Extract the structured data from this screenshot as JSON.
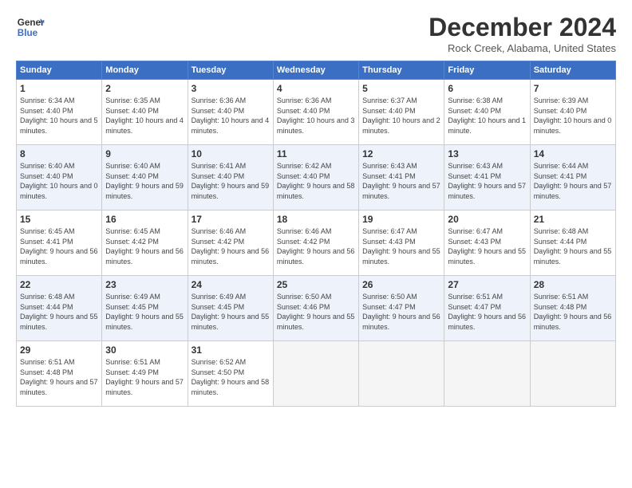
{
  "header": {
    "logo_line1": "General",
    "logo_line2": "Blue",
    "month_title": "December 2024",
    "location": "Rock Creek, Alabama, United States"
  },
  "days_of_week": [
    "Sunday",
    "Monday",
    "Tuesday",
    "Wednesday",
    "Thursday",
    "Friday",
    "Saturday"
  ],
  "weeks": [
    [
      {
        "day": "1",
        "sunrise": "6:34 AM",
        "sunset": "4:40 PM",
        "daylight": "10 hours and 5 minutes."
      },
      {
        "day": "2",
        "sunrise": "6:35 AM",
        "sunset": "4:40 PM",
        "daylight": "10 hours and 4 minutes."
      },
      {
        "day": "3",
        "sunrise": "6:36 AM",
        "sunset": "4:40 PM",
        "daylight": "10 hours and 4 minutes."
      },
      {
        "day": "4",
        "sunrise": "6:36 AM",
        "sunset": "4:40 PM",
        "daylight": "10 hours and 3 minutes."
      },
      {
        "day": "5",
        "sunrise": "6:37 AM",
        "sunset": "4:40 PM",
        "daylight": "10 hours and 2 minutes."
      },
      {
        "day": "6",
        "sunrise": "6:38 AM",
        "sunset": "4:40 PM",
        "daylight": "10 hours and 1 minute."
      },
      {
        "day": "7",
        "sunrise": "6:39 AM",
        "sunset": "4:40 PM",
        "daylight": "10 hours and 0 minutes."
      }
    ],
    [
      {
        "day": "8",
        "sunrise": "6:40 AM",
        "sunset": "4:40 PM",
        "daylight": "10 hours and 0 minutes."
      },
      {
        "day": "9",
        "sunrise": "6:40 AM",
        "sunset": "4:40 PM",
        "daylight": "9 hours and 59 minutes."
      },
      {
        "day": "10",
        "sunrise": "6:41 AM",
        "sunset": "4:40 PM",
        "daylight": "9 hours and 59 minutes."
      },
      {
        "day": "11",
        "sunrise": "6:42 AM",
        "sunset": "4:40 PM",
        "daylight": "9 hours and 58 minutes."
      },
      {
        "day": "12",
        "sunrise": "6:43 AM",
        "sunset": "4:41 PM",
        "daylight": "9 hours and 57 minutes."
      },
      {
        "day": "13",
        "sunrise": "6:43 AM",
        "sunset": "4:41 PM",
        "daylight": "9 hours and 57 minutes."
      },
      {
        "day": "14",
        "sunrise": "6:44 AM",
        "sunset": "4:41 PM",
        "daylight": "9 hours and 57 minutes."
      }
    ],
    [
      {
        "day": "15",
        "sunrise": "6:45 AM",
        "sunset": "4:41 PM",
        "daylight": "9 hours and 56 minutes."
      },
      {
        "day": "16",
        "sunrise": "6:45 AM",
        "sunset": "4:42 PM",
        "daylight": "9 hours and 56 minutes."
      },
      {
        "day": "17",
        "sunrise": "6:46 AM",
        "sunset": "4:42 PM",
        "daylight": "9 hours and 56 minutes."
      },
      {
        "day": "18",
        "sunrise": "6:46 AM",
        "sunset": "4:42 PM",
        "daylight": "9 hours and 56 minutes."
      },
      {
        "day": "19",
        "sunrise": "6:47 AM",
        "sunset": "4:43 PM",
        "daylight": "9 hours and 55 minutes."
      },
      {
        "day": "20",
        "sunrise": "6:47 AM",
        "sunset": "4:43 PM",
        "daylight": "9 hours and 55 minutes."
      },
      {
        "day": "21",
        "sunrise": "6:48 AM",
        "sunset": "4:44 PM",
        "daylight": "9 hours and 55 minutes."
      }
    ],
    [
      {
        "day": "22",
        "sunrise": "6:48 AM",
        "sunset": "4:44 PM",
        "daylight": "9 hours and 55 minutes."
      },
      {
        "day": "23",
        "sunrise": "6:49 AM",
        "sunset": "4:45 PM",
        "daylight": "9 hours and 55 minutes."
      },
      {
        "day": "24",
        "sunrise": "6:49 AM",
        "sunset": "4:45 PM",
        "daylight": "9 hours and 55 minutes."
      },
      {
        "day": "25",
        "sunrise": "6:50 AM",
        "sunset": "4:46 PM",
        "daylight": "9 hours and 55 minutes."
      },
      {
        "day": "26",
        "sunrise": "6:50 AM",
        "sunset": "4:47 PM",
        "daylight": "9 hours and 56 minutes."
      },
      {
        "day": "27",
        "sunrise": "6:51 AM",
        "sunset": "4:47 PM",
        "daylight": "9 hours and 56 minutes."
      },
      {
        "day": "28",
        "sunrise": "6:51 AM",
        "sunset": "4:48 PM",
        "daylight": "9 hours and 56 minutes."
      }
    ],
    [
      {
        "day": "29",
        "sunrise": "6:51 AM",
        "sunset": "4:48 PM",
        "daylight": "9 hours and 57 minutes."
      },
      {
        "day": "30",
        "sunrise": "6:51 AM",
        "sunset": "4:49 PM",
        "daylight": "9 hours and 57 minutes."
      },
      {
        "day": "31",
        "sunrise": "6:52 AM",
        "sunset": "4:50 PM",
        "daylight": "9 hours and 58 minutes."
      },
      null,
      null,
      null,
      null
    ]
  ],
  "labels": {
    "sunrise": "Sunrise:",
    "sunset": "Sunset:",
    "daylight": "Daylight:"
  }
}
